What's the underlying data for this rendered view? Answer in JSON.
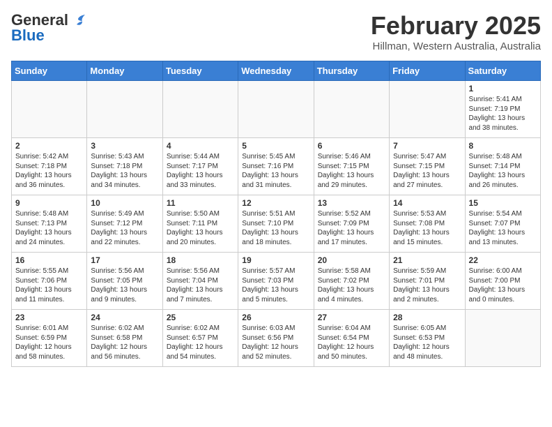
{
  "header": {
    "logo_general": "General",
    "logo_blue": "Blue",
    "month_title": "February 2025",
    "location": "Hillman, Western Australia, Australia"
  },
  "days_of_week": [
    "Sunday",
    "Monday",
    "Tuesday",
    "Wednesday",
    "Thursday",
    "Friday",
    "Saturday"
  ],
  "weeks": [
    [
      {
        "day": "",
        "info": ""
      },
      {
        "day": "",
        "info": ""
      },
      {
        "day": "",
        "info": ""
      },
      {
        "day": "",
        "info": ""
      },
      {
        "day": "",
        "info": ""
      },
      {
        "day": "",
        "info": ""
      },
      {
        "day": "1",
        "info": "Sunrise: 5:41 AM\nSunset: 7:19 PM\nDaylight: 13 hours\nand 38 minutes."
      }
    ],
    [
      {
        "day": "2",
        "info": "Sunrise: 5:42 AM\nSunset: 7:18 PM\nDaylight: 13 hours\nand 36 minutes."
      },
      {
        "day": "3",
        "info": "Sunrise: 5:43 AM\nSunset: 7:18 PM\nDaylight: 13 hours\nand 34 minutes."
      },
      {
        "day": "4",
        "info": "Sunrise: 5:44 AM\nSunset: 7:17 PM\nDaylight: 13 hours\nand 33 minutes."
      },
      {
        "day": "5",
        "info": "Sunrise: 5:45 AM\nSunset: 7:16 PM\nDaylight: 13 hours\nand 31 minutes."
      },
      {
        "day": "6",
        "info": "Sunrise: 5:46 AM\nSunset: 7:15 PM\nDaylight: 13 hours\nand 29 minutes."
      },
      {
        "day": "7",
        "info": "Sunrise: 5:47 AM\nSunset: 7:15 PM\nDaylight: 13 hours\nand 27 minutes."
      },
      {
        "day": "8",
        "info": "Sunrise: 5:48 AM\nSunset: 7:14 PM\nDaylight: 13 hours\nand 26 minutes."
      }
    ],
    [
      {
        "day": "9",
        "info": "Sunrise: 5:48 AM\nSunset: 7:13 PM\nDaylight: 13 hours\nand 24 minutes."
      },
      {
        "day": "10",
        "info": "Sunrise: 5:49 AM\nSunset: 7:12 PM\nDaylight: 13 hours\nand 22 minutes."
      },
      {
        "day": "11",
        "info": "Sunrise: 5:50 AM\nSunset: 7:11 PM\nDaylight: 13 hours\nand 20 minutes."
      },
      {
        "day": "12",
        "info": "Sunrise: 5:51 AM\nSunset: 7:10 PM\nDaylight: 13 hours\nand 18 minutes."
      },
      {
        "day": "13",
        "info": "Sunrise: 5:52 AM\nSunset: 7:09 PM\nDaylight: 13 hours\nand 17 minutes."
      },
      {
        "day": "14",
        "info": "Sunrise: 5:53 AM\nSunset: 7:08 PM\nDaylight: 13 hours\nand 15 minutes."
      },
      {
        "day": "15",
        "info": "Sunrise: 5:54 AM\nSunset: 7:07 PM\nDaylight: 13 hours\nand 13 minutes."
      }
    ],
    [
      {
        "day": "16",
        "info": "Sunrise: 5:55 AM\nSunset: 7:06 PM\nDaylight: 13 hours\nand 11 minutes."
      },
      {
        "day": "17",
        "info": "Sunrise: 5:56 AM\nSunset: 7:05 PM\nDaylight: 13 hours\nand 9 minutes."
      },
      {
        "day": "18",
        "info": "Sunrise: 5:56 AM\nSunset: 7:04 PM\nDaylight: 13 hours\nand 7 minutes."
      },
      {
        "day": "19",
        "info": "Sunrise: 5:57 AM\nSunset: 7:03 PM\nDaylight: 13 hours\nand 5 minutes."
      },
      {
        "day": "20",
        "info": "Sunrise: 5:58 AM\nSunset: 7:02 PM\nDaylight: 13 hours\nand 4 minutes."
      },
      {
        "day": "21",
        "info": "Sunrise: 5:59 AM\nSunset: 7:01 PM\nDaylight: 13 hours\nand 2 minutes."
      },
      {
        "day": "22",
        "info": "Sunrise: 6:00 AM\nSunset: 7:00 PM\nDaylight: 13 hours\nand 0 minutes."
      }
    ],
    [
      {
        "day": "23",
        "info": "Sunrise: 6:01 AM\nSunset: 6:59 PM\nDaylight: 12 hours\nand 58 minutes."
      },
      {
        "day": "24",
        "info": "Sunrise: 6:02 AM\nSunset: 6:58 PM\nDaylight: 12 hours\nand 56 minutes."
      },
      {
        "day": "25",
        "info": "Sunrise: 6:02 AM\nSunset: 6:57 PM\nDaylight: 12 hours\nand 54 minutes."
      },
      {
        "day": "26",
        "info": "Sunrise: 6:03 AM\nSunset: 6:56 PM\nDaylight: 12 hours\nand 52 minutes."
      },
      {
        "day": "27",
        "info": "Sunrise: 6:04 AM\nSunset: 6:54 PM\nDaylight: 12 hours\nand 50 minutes."
      },
      {
        "day": "28",
        "info": "Sunrise: 6:05 AM\nSunset: 6:53 PM\nDaylight: 12 hours\nand 48 minutes."
      },
      {
        "day": "",
        "info": ""
      }
    ]
  ]
}
